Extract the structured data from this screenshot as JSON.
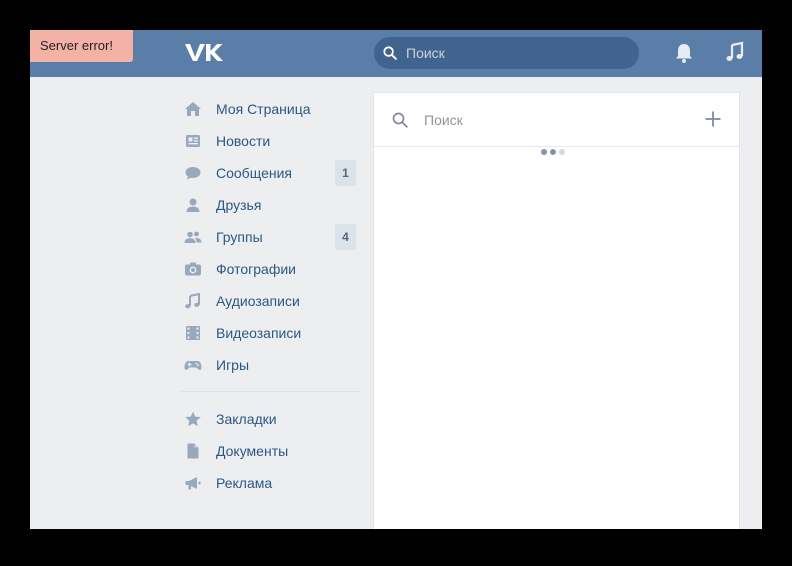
{
  "error_banner": {
    "text": "Server error!"
  },
  "header": {
    "logo": "vk-logo",
    "search": {
      "placeholder": "Поиск",
      "value": ""
    },
    "icons": [
      "bell-icon",
      "music-note-icon"
    ]
  },
  "sidebar": {
    "items": [
      {
        "label": "Моя Страница",
        "icon": "home-icon"
      },
      {
        "label": "Новости",
        "icon": "newspaper-icon"
      },
      {
        "label": "Сообщения",
        "icon": "chat-bubble-icon",
        "count": "1"
      },
      {
        "label": "Друзья",
        "icon": "person-icon"
      },
      {
        "label": "Группы",
        "icon": "group-icon",
        "count": "4"
      },
      {
        "label": "Фотографии",
        "icon": "camera-icon"
      },
      {
        "label": "Аудиозаписи",
        "icon": "music-note-icon"
      },
      {
        "label": "Видеозаписи",
        "icon": "film-icon"
      },
      {
        "label": "Игры",
        "icon": "gamepad-icon"
      }
    ],
    "secondary_items": [
      {
        "label": "Закладки",
        "icon": "star-icon"
      },
      {
        "label": "Документы",
        "icon": "document-icon"
      },
      {
        "label": "Реклама",
        "icon": "megaphone-icon"
      }
    ]
  },
  "panel": {
    "search": {
      "placeholder": "Поиск",
      "value": ""
    },
    "add_icon": "plus-icon",
    "loading": true
  },
  "colors": {
    "header_bg": "#5b7ea8",
    "header_search_bg": "#41648e",
    "page_bg": "#edeef0",
    "link": "#2a5885",
    "icon_gray": "#99a9bb",
    "badge_bg": "#dae2ea",
    "error_bg": "#f3b2a5"
  }
}
